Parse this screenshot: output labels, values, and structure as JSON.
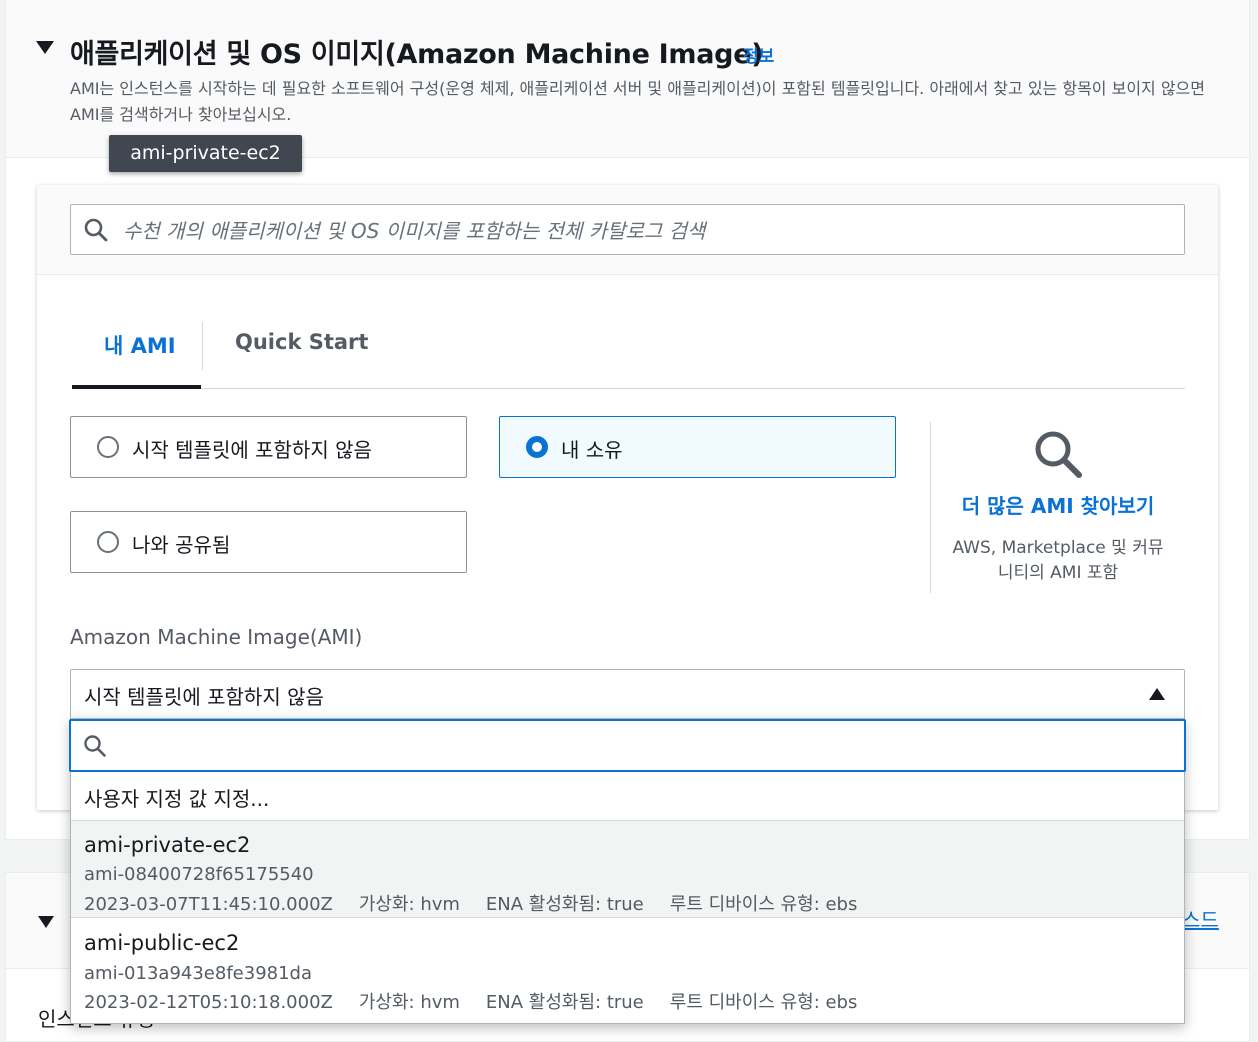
{
  "section": {
    "title": "애플리케이션 및 OS 이미지(Amazon Machine Image)",
    "info_link": "정보",
    "description": "AMI는 인스턴스를 시작하는 데 필요한 소프트웨어 구성(운영 체제, 애플리케이션 서버 및 애플리케이션)이 포함된 템플릿입니다. 아래에서 찾고 있는 항목이 보이지 않으면 AMI를 검색하거나 찾아보십시오."
  },
  "tooltip": "ami-private-ec2",
  "catalog_search": {
    "placeholder": "수천 개의 애플리케이션 및 OS 이미지를 포함하는 전체 카탈로그 검색",
    "icon": "search-icon"
  },
  "tabs": [
    {
      "label": "내 AMI",
      "active": true
    },
    {
      "label": "Quick Start",
      "active": false
    }
  ],
  "radio_options": [
    {
      "label": "시작 템플릿에 포함하지 않음",
      "selected": false
    },
    {
      "label": "내 소유",
      "selected": true
    },
    {
      "label": "나와 공유됨",
      "selected": false
    }
  ],
  "browse": {
    "link": "더 많은 AMI 찾아보기",
    "description": "AWS, Marketplace 및 커뮤니티의 AMI 포함",
    "icon": "search-icon"
  },
  "ami_select": {
    "label": "Amazon Machine Image(AMI)",
    "value": "시작 템플릿에 포함하지 않음",
    "filter_value": "",
    "custom_value": "사용자 지정 값 지정...",
    "options": [
      {
        "name": "ami-private-ec2",
        "id": "ami-08400728f65175540",
        "date": "2023-03-07T11:45:10.000Z",
        "virtualization": "가상화: hvm",
        "ena": "ENA 활성화됨: true",
        "root_device": "루트 디바이스 유형: ebs",
        "highlighted": true
      },
      {
        "name": "ami-public-ec2",
        "id": "ami-013a943e8fe3981da",
        "date": "2023-02-12T05:10:18.000Z",
        "virtualization": "가상화: hvm",
        "ena": "ENA 활성화됨: true",
        "root_device": "루트 디바이스 유형: ebs",
        "highlighted": false
      }
    ]
  },
  "next_section": {
    "link_fragment": "스드",
    "label_fragment": "인스턴스 유형"
  },
  "colors": {
    "accent": "#0972d3",
    "text": "#16191f",
    "muted": "#545b64",
    "selected_tile_bg": "#f1faff"
  }
}
